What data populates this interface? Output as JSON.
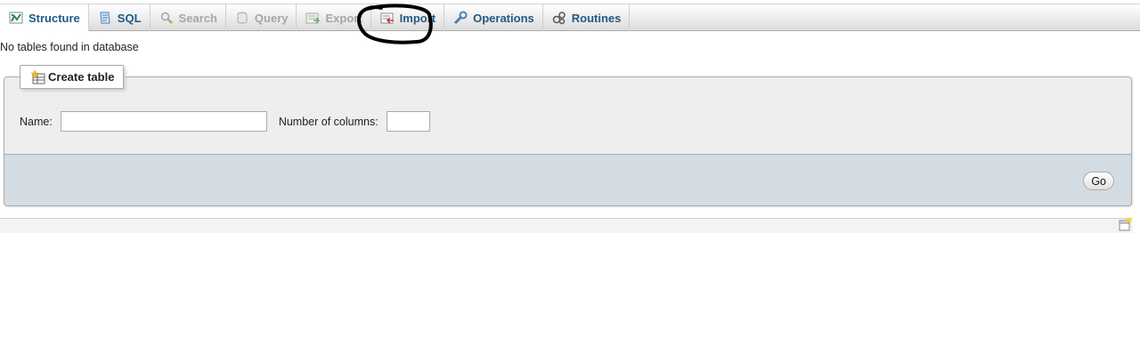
{
  "tabs": [
    {
      "label": "Structure",
      "icon": "structure-icon",
      "state": "active"
    },
    {
      "label": "SQL",
      "icon": "sql-icon",
      "state": "normal"
    },
    {
      "label": "Search",
      "icon": "search-icon",
      "state": "disabled"
    },
    {
      "label": "Query",
      "icon": "query-icon",
      "state": "disabled"
    },
    {
      "label": "Export",
      "icon": "export-icon",
      "state": "disabled"
    },
    {
      "label": "Import",
      "icon": "import-icon",
      "state": "normal"
    },
    {
      "label": "Operations",
      "icon": "operations-icon",
      "state": "normal"
    },
    {
      "label": "Routines",
      "icon": "routines-icon",
      "state": "normal"
    }
  ],
  "notice": "No tables found in database",
  "create_table": {
    "legend": "Create table",
    "name_label": "Name:",
    "name_value": "",
    "columns_label": "Number of columns:",
    "columns_value": "",
    "go_label": "Go"
  },
  "colors": {
    "tab_text": "#235a81",
    "disabled_text": "#a6a6a6",
    "fieldset_bg": "#eeeeee",
    "footer_bg": "#d3dce3",
    "annotation": "#000000"
  },
  "annotation": {
    "shape": "hand-drawn circle",
    "target": "Import tab"
  }
}
